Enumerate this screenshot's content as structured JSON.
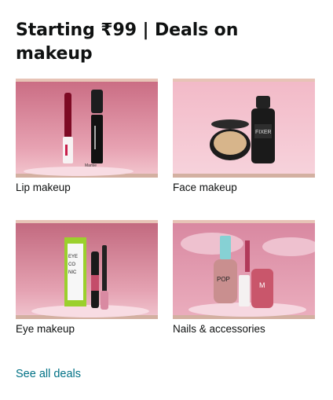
{
  "card": {
    "title": "Starting ₹99 | Deals on makeup",
    "tiles": [
      {
        "label": "Lip makeup",
        "image": "lip-makeup-product-image"
      },
      {
        "label": "Face makeup",
        "image": "face-makeup-product-image"
      },
      {
        "label": "Eye makeup",
        "image": "eye-makeup-product-image"
      },
      {
        "label": "Nails & accessories",
        "image": "nails-accessories-product-image"
      }
    ],
    "see_all_label": "See all deals"
  },
  "colors": {
    "link": "#007185",
    "text": "#0f1111",
    "tile_background": "#e9a3b3"
  }
}
